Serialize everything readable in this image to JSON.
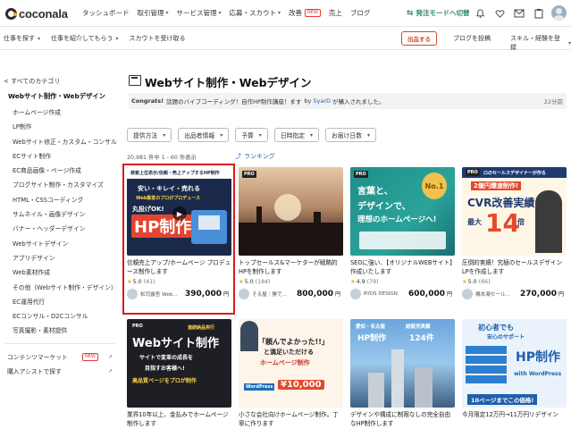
{
  "header": {
    "logo": "coconala",
    "nav": [
      {
        "label": "タッシュボード",
        "caret": false
      },
      {
        "label": "取引管理",
        "caret": true
      },
      {
        "label": "サービス管理",
        "caret": true
      },
      {
        "label": "応募・スカウト",
        "caret": true
      },
      {
        "label": "改善",
        "caret": false,
        "badge": "NEW"
      },
      {
        "label": "売上",
        "caret": false
      },
      {
        "label": "ブログ",
        "caret": false
      }
    ],
    "mode_switch": "発注モードへ切替",
    "icons": [
      "bell-icon",
      "heart-icon",
      "mail-icon",
      "clipboard-icon"
    ]
  },
  "subbar": {
    "left": [
      {
        "label": "仕事を探す",
        "caret": true
      },
      {
        "label": "仕事を紹介してもらう",
        "caret": true
      },
      {
        "label": "スカウトを受け取る",
        "caret": false
      }
    ],
    "publish_button": "出品する",
    "blog_post": "ブログを投稿",
    "skills": "スキル・経験を登録"
  },
  "sidebar": {
    "back": "< すべてのカテゴリ",
    "title": "Webサイト制作・Webデザイン",
    "items": [
      "ホームページ作成",
      "LP制作",
      "Webサイト修正・カスタム・コンサル",
      "ECサイト制作",
      "EC商品画像・ページ作成",
      "ブログサイト制作・カスタマイズ",
      "HTML・CSSコーディング",
      "サムネイル・画像デザイン",
      "バナー・ヘッダーデザイン",
      "Webサイトデザイン",
      "アプリデザイン",
      "Web素材作成",
      "その他（Webサイト制作・デザイン）",
      "EC運用代行",
      "ECコンサル・D2Cコンサル",
      "写真撮影・素材提供"
    ],
    "content_market": "コンテンツマーケット",
    "content_market_badge": "NEW",
    "purchase_assist": "購入アシストで探す"
  },
  "main": {
    "title": "Webサイト制作・Webデザイン",
    "notice": {
      "prefix": "Congrats!",
      "text": "話題のバイブコーディング！自作HP制作講座！ます",
      "by": "by",
      "user": "SyarD",
      "suffix": "が購入されました。",
      "time": "22分前"
    },
    "filters": [
      "提供方法",
      "出品者情報",
      "予算",
      "日時指定",
      "お届け日数"
    ],
    "result_count": "20,981 件中 1 - 60 件表示",
    "ranking": "ランキング"
  },
  "cards": [
    {
      "title": "信頼売上アップ/ホームページ プロデュース制作します",
      "rating": "5.0",
      "count": "(41)",
      "seller": "松司露吾 Web...",
      "price": "390,000",
      "thumb_lines": [
        "検索上位表示/信頼・売上アップするHP制作",
        "安い・キレイ・売れる",
        "Web集客のプロがプロデュース",
        "丸投げOK!",
        "HP制作"
      ],
      "pro": false
    },
    {
      "title": "トップセールス&マーケターが戦略的HPを制作します",
      "rating": "5.0",
      "count": "(184)",
      "seller": "そる屋｜勝で...",
      "price": "800,000",
      "thumb_lines": [],
      "pro": true
    },
    {
      "title": "SEOに強い、【オリジナルWEBサイト】作成いたします",
      "rating": "4.9",
      "count": "(79)",
      "seller": "RYOS DESIGN",
      "price": "600,000",
      "thumb_lines": [
        "言葉と、",
        "デザインで、",
        "理想のホームページへ!",
        "No.1"
      ],
      "pro": true
    },
    {
      "title": "圧倒的実績！究極のセールスデザインLPを作成します",
      "rating": "5.0",
      "count": "(66)",
      "seller": "橋本凝セール...",
      "price": "270,000",
      "thumb_lines": [
        "ロのセールスデザイナーが作る",
        "2億円爆速制作!",
        "CVR改善実績",
        "最大",
        "14",
        "倍"
      ],
      "pro": true
    },
    {
      "title": "業界10年以上、金払みでホームページ制作します",
      "rating": "",
      "count": "",
      "seller": "",
      "price": "",
      "thumb_lines": [
        "連続納品実行",
        "Webサイト制作",
        "サイトで変革の成長を",
        "目指すお客様へ!",
        "高品質ページをプロが制作"
      ],
      "pro": true
    },
    {
      "title": "小さな会社向けホームページ制作。丁寧に作ります",
      "rating": "",
      "count": "",
      "seller": "",
      "price": "",
      "thumb_lines": [
        "「頼んでよかった!!」",
        "と満足いただける",
        "ホームページ制作",
        "WordPress",
        "¥10,000"
      ],
      "pro": false
    },
    {
      "title": "デザインや構成に制限なしの完全自由なHP制作します",
      "rating": "",
      "count": "",
      "seller": "",
      "price": "",
      "thumb_lines": [
        "愛知・名古屋",
        "総販売実績",
        "HP制作",
        "124件"
      ],
      "pro": false
    },
    {
      "title": "今月限定12万円→11万円リデザイン",
      "rating": "",
      "count": "",
      "seller": "",
      "price": "",
      "thumb_lines": [
        "初心者でも",
        "安心のサポート",
        "HP制作",
        "with WordPress",
        "10ページまでこの価格!"
      ],
      "pro": false
    }
  ],
  "yen": "円",
  "colors": {
    "brand_green": "#2e8b6a",
    "accent_red": "#d91c1c",
    "link_blue": "#2a62b8",
    "star": "#f5a623"
  }
}
